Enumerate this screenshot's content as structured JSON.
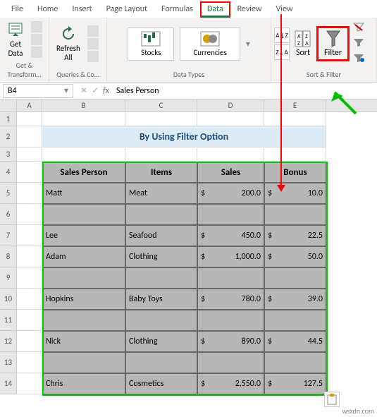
{
  "tabs": {
    "file": "File",
    "home": "Home",
    "insert": "Insert",
    "page_layout": "Page Layout",
    "formulas": "Formulas",
    "data": "Data",
    "review": "Review",
    "view": "View"
  },
  "ribbon": {
    "get_data": "Get\nData",
    "refresh_all": "Refresh\nAll",
    "stocks": "Stocks",
    "currencies": "Currencies",
    "sort": "Sort",
    "filter": "Filter",
    "group_transform": "Get & Transform…",
    "group_queries": "Queries & Co…",
    "group_datatypes": "Data Types",
    "group_sortfilter": "Sort & Filter",
    "sort_asc": "A↓Z",
    "sort_desc": "Z↓A"
  },
  "namebox": "B4",
  "formula": "Sales Person",
  "columns": {
    "A": "A",
    "B": "B",
    "C": "C",
    "D": "D",
    "E": "E"
  },
  "rows": [
    "1",
    "2",
    "3",
    "4",
    "5",
    "6",
    "7",
    "8",
    "9",
    "10",
    "11",
    "12",
    "13",
    "14"
  ],
  "sheet": {
    "title": "By Using Filter Option",
    "headers": {
      "person": "Sales Person",
      "items": "Items",
      "sales": "Sales",
      "bonus": "Bonus"
    },
    "data": [
      {
        "person": "Matt",
        "items": "Meat",
        "sales": "200.0",
        "bonus": "10.0"
      },
      {
        "person": "",
        "items": "",
        "sales": "",
        "bonus": ""
      },
      {
        "person": "Lee",
        "items": "Seafood",
        "sales": "450.0",
        "bonus": "22.5"
      },
      {
        "person": "Adam",
        "items": "Clothing",
        "sales": "1,000.0",
        "bonus": "50.0"
      },
      {
        "person": "",
        "items": "",
        "sales": "",
        "bonus": ""
      },
      {
        "person": "Hopkins",
        "items": "Baby Toys",
        "sales": "780.0",
        "bonus": "39.0"
      },
      {
        "person": "",
        "items": "",
        "sales": "",
        "bonus": ""
      },
      {
        "person": "Nick",
        "items": "Clothing",
        "sales": "890.0",
        "bonus": "44.5"
      },
      {
        "person": "",
        "items": "",
        "sales": "",
        "bonus": ""
      },
      {
        "person": "Chris",
        "items": "Cosmetics",
        "sales": "2,550.0",
        "bonus": "127.5"
      }
    ],
    "currency": "$"
  },
  "watermark": "wsxdn.com"
}
